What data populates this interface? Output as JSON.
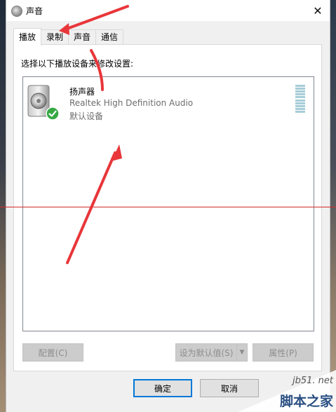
{
  "window": {
    "title": "声音"
  },
  "tabs": [
    {
      "label": "播放",
      "active": true
    },
    {
      "label": "录制",
      "active": false
    },
    {
      "label": "声音",
      "active": false
    },
    {
      "label": "通信",
      "active": false
    }
  ],
  "instruction": "选择以下播放设备来修改设置:",
  "devices": [
    {
      "name": "扬声器",
      "driver": "Realtek High Definition Audio",
      "status": "默认设备",
      "icon": "speaker-icon",
      "status_icon": "check-icon",
      "level_icon": "level-meter"
    }
  ],
  "buttons": {
    "configure": "配置(C)",
    "set_default": "设为默认值(S)",
    "properties": "属性(P)",
    "ok": "确定",
    "cancel": "取消"
  },
  "watermark": {
    "url": "jb51. net",
    "text": "脚本之家"
  },
  "colors": {
    "annotation_red": "#e8363a",
    "check_green": "#36a843",
    "focus_blue": "#0078d7"
  }
}
